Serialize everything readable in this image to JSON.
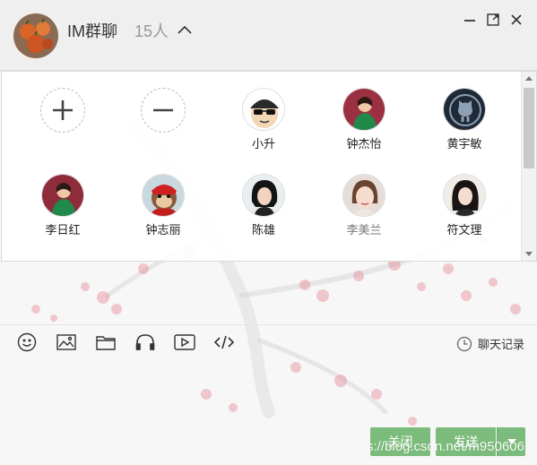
{
  "header": {
    "title": "IM群聊",
    "member_count": "15人"
  },
  "members": [
    {
      "name": "小升",
      "avatar": "cartoon-sunglasses"
    },
    {
      "name": "钟杰怡",
      "avatar": "photo-green"
    },
    {
      "name": "黄宇敏",
      "avatar": "github-octocat"
    },
    {
      "name": "李日红",
      "avatar": "photo-green"
    },
    {
      "name": "钟志丽",
      "avatar": "monkey-red"
    },
    {
      "name": "陈雄",
      "avatar": "photo-girl"
    },
    {
      "name": "李美兰",
      "avatar": "photo-girl-light",
      "muted": true
    },
    {
      "name": "符文理",
      "avatar": "photo-girl-dark"
    }
  ],
  "toolbar": {
    "tools": [
      "emoji-icon",
      "image-icon",
      "folder-icon",
      "headphones-icon",
      "video-icon",
      "code-icon"
    ],
    "history_label": "聊天记录"
  },
  "buttons": {
    "close_label": "关闭",
    "send_label": "发送"
  },
  "watermark": "https://blog.csdn.net/m950606",
  "colors": {
    "button_green": "#7bbb7b",
    "header_bg": "#efefef"
  }
}
